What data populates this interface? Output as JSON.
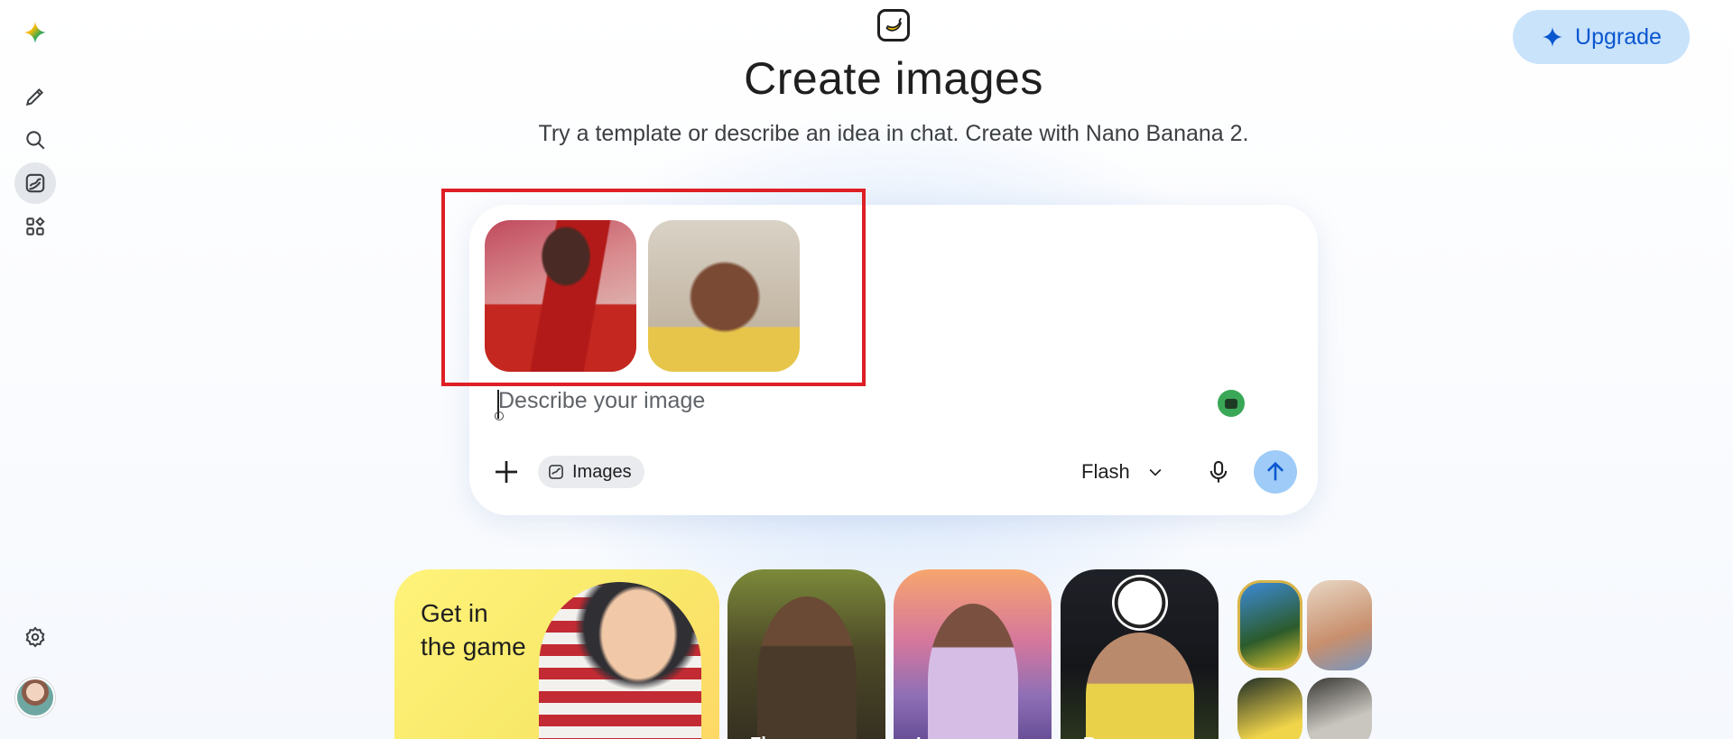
{
  "sidebar": {
    "items": [
      {
        "icon": "gemini-logo-icon"
      },
      {
        "icon": "new-chat-icon"
      },
      {
        "icon": "search-icon"
      },
      {
        "icon": "images-icon",
        "active": true
      },
      {
        "icon": "apps-icon"
      }
    ],
    "bottom": [
      {
        "icon": "settings-gear-icon"
      },
      {
        "icon": "user-avatar"
      }
    ]
  },
  "header": {
    "upgrade_label": "Upgrade"
  },
  "hero": {
    "title": "Create images",
    "subtitle": "Try a template or describe an idea in chat. Create with Nano Banana 2."
  },
  "composer": {
    "placeholder": "Describe your image",
    "chip_label": "Images",
    "model_label": "Flash",
    "attachments": [
      {
        "name": "attached-image-1"
      },
      {
        "name": "attached-image-2"
      }
    ]
  },
  "templates": [
    {
      "label": "Get in\nthe game"
    },
    {
      "label": "Fl"
    },
    {
      "label": "I"
    },
    {
      "label": "B"
    }
  ],
  "colors": {
    "accent": "#0b57d0",
    "upgrade_bg": "#c9e3fb",
    "send_bg": "#9ecbf7",
    "highlight": "#de1f25"
  }
}
